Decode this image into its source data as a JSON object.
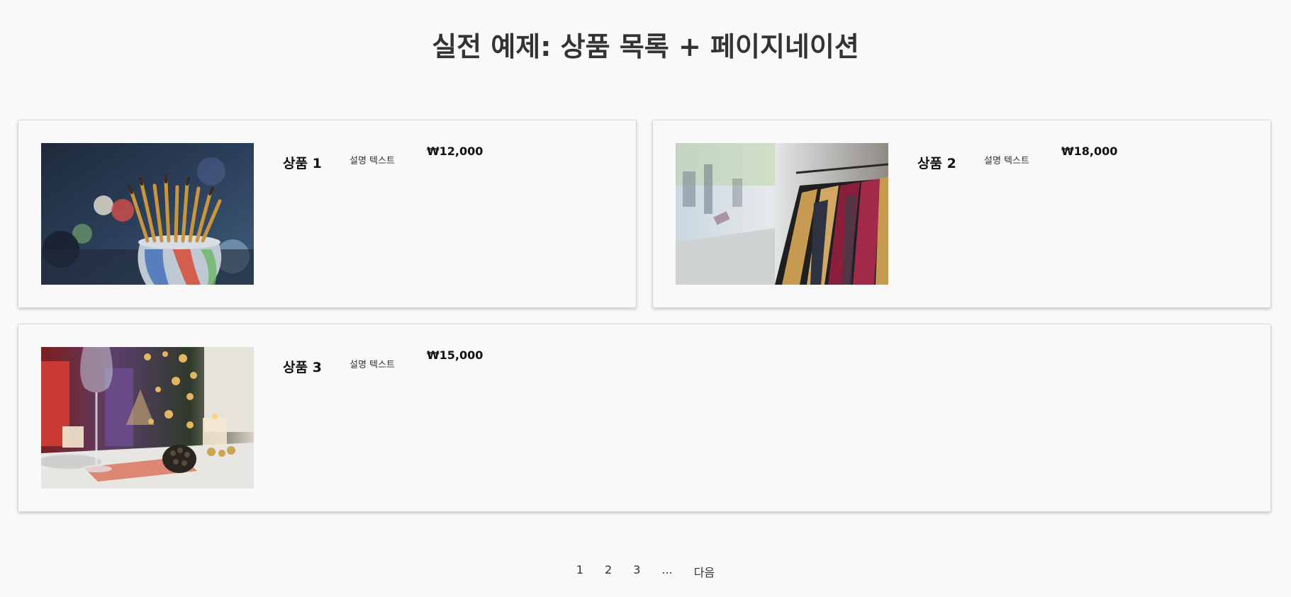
{
  "page": {
    "title": "실전 예제: 상품 목록 + 페이지네이션"
  },
  "products": [
    {
      "name": "상품 1",
      "description": "설명 텍스트",
      "price": "₩12,000",
      "image": "paintbrushes-in-jar-photo"
    },
    {
      "name": "상품 2",
      "description": "설명 텍스트",
      "price": "₩18,000",
      "image": "clothes-rack-photo"
    },
    {
      "name": "상품 3",
      "description": "설명 텍스트",
      "price": "₩15,000",
      "image": "festive-table-pinecone-photo"
    }
  ],
  "pagination": {
    "pages": [
      "1",
      "2",
      "3"
    ],
    "ellipsis": "...",
    "next_label": "다음"
  }
}
